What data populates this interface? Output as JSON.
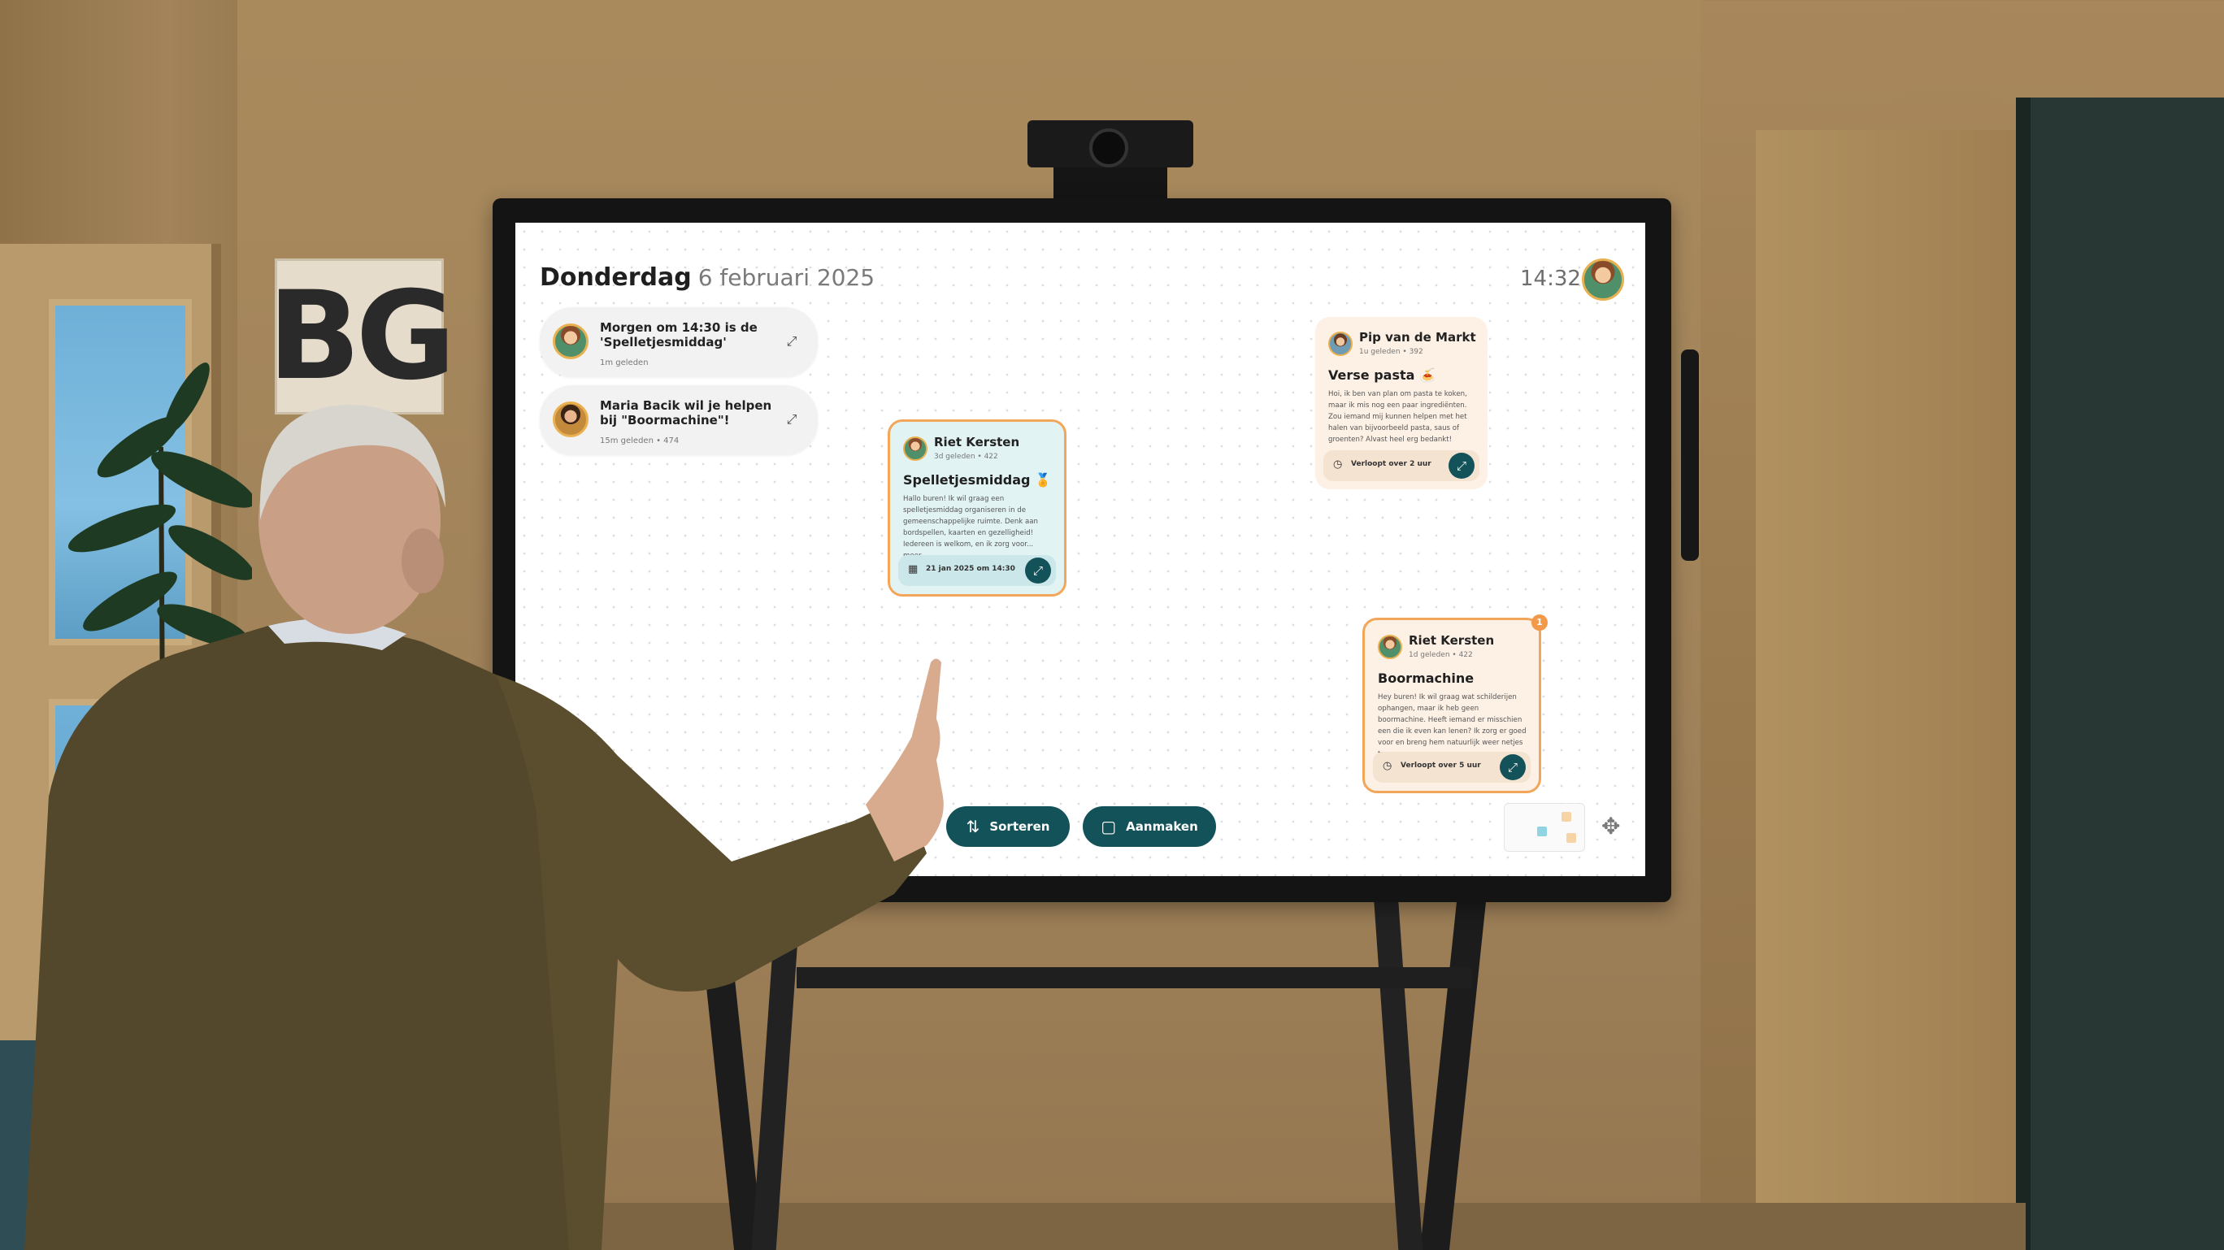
{
  "sign": {
    "text": "BG"
  },
  "screen": {
    "header": {
      "day": "Donderdag",
      "date": "6 februari 2025",
      "time": "14:32"
    },
    "notifications": [
      {
        "title": "Morgen om 14:30 is de 'Spelletjesmiddag'",
        "meta": "1m geleden",
        "icon": "expand-icon"
      },
      {
        "title": "Maria Bacik wil je helpen bij \"Boormachine\"!",
        "meta": "15m geleden • 474",
        "icon": "expand-icon"
      }
    ],
    "cards": {
      "spelletjes": {
        "author": "Riet Kersten",
        "meta": "3d geleden • 422",
        "title": "Spelletjesmiddag 🏅",
        "body": "Hallo buren! Ik wil graag een spelletjesmiddag organiseren in de gemeenschappelijke ruimte. Denk aan bordspellen, kaarten en gezelligheid! Iedereen is welkom, en ik zorg voor... meer",
        "footer": "21 jan 2025 om 14:30",
        "footer_icon": "calendar-icon"
      },
      "pasta": {
        "author": "Pip van de Markt",
        "meta": "1u geleden • 392",
        "title": "Verse pasta 🍝",
        "body": "Hoi, ik ben van plan om pasta te koken, maar ik mis nog een paar ingrediënten. Zou iemand mij kunnen helpen met het halen van bijvoorbeeld pasta, saus of groenten? Alvast heel erg bedankt!",
        "footer": "Verloopt over 2 uur",
        "footer_icon": "clock-icon"
      },
      "boormachine": {
        "author": "Riet Kersten",
        "meta": "1d geleden • 422",
        "title": "Boormachine",
        "body": "Hey buren! Ik wil graag wat schilderijen ophangen, maar ik heb geen boormachine. Heeft iemand er misschien een die ik even kan lenen? Ik zorg er goed voor en breng hem natuurlijk weer netjes terug... meer",
        "footer": "Verloopt over 5 uur",
        "footer_icon": "clock-icon",
        "badge": "1"
      }
    },
    "buttons": {
      "sort": "Sorteren",
      "create": "Aanmaken"
    },
    "colors": {
      "primary": "#14525a",
      "accent": "#f2a65a",
      "card_blue": "#e2f3f4",
      "card_peach": "#fdf0e4"
    }
  }
}
